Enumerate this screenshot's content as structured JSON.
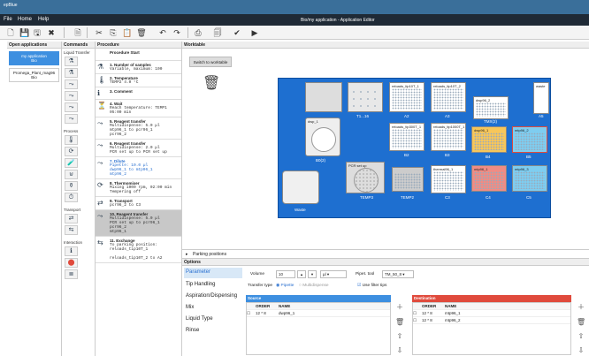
{
  "window": {
    "app": "epBlue",
    "title": "Bio/my application - Application Editor"
  },
  "menu": [
    "File",
    "Home",
    "Help"
  ],
  "panels": {
    "open": "Open applications",
    "commands": "Commands",
    "procedure": "Procedure",
    "worktable": "Worktable",
    "options": "Options"
  },
  "apps": [
    {
      "name": "my application",
      "sub": "Bio"
    },
    {
      "name": "Promega_Plant_mag96",
      "sub": "Bio"
    }
  ],
  "cmdgroups": [
    "Liquid Transfer",
    "Process",
    "Transport",
    "Interaction"
  ],
  "steps": [
    {
      "t": "Procedure Start",
      "d": ""
    },
    {
      "t": "1. Number of samples",
      "d": "Variable, maximum: 100"
    },
    {
      "t": "2. Temperature",
      "d": "TEMP2 4.0 °C"
    },
    {
      "t": "3. Comment",
      "d": ""
    },
    {
      "t": "4. Wait",
      "d": "Reach temperature: TEMP1\n05:00 min"
    },
    {
      "t": "5. Reagent transfer",
      "d": "Multidispense: 5.0 µl\nmtp96_1 to pcr96_1\npcr96_2"
    },
    {
      "t": "6. Reagent transfer",
      "d": "Multidispense: 2.0 µl\nPCR set up to PCR set up"
    },
    {
      "t": "7. Dilute",
      "d": "Pipette: 10.0 µl\ndwp96_1 to mtp96_1\nmtp96_2"
    },
    {
      "t": "8. Thermomixer",
      "d": "Mixing 1000 rpm, 02:00 min\nTempering off"
    },
    {
      "t": "9. Transport",
      "d": "pcr96_2 to C3"
    },
    {
      "t": "10. Reagent transfer",
      "d": "Multidispense: 5.0 µl\nPCR set up to pcr96_1\npcr96_2\nmtp96_1"
    },
    {
      "t": "11. Exchange",
      "d": "To parking position:\nreloads_tip10T_1\n\nreloads_tip10T_2 to A2"
    }
  ],
  "worktable": {
    "switch": "Switch to worktable",
    "parking": "Parking positions"
  },
  "labware": {
    "a1": "T1...16",
    "a2": "reloads_tip10T_1",
    "a2p": "A2",
    "a3": "reloads_tip10T_2",
    "a3p": "A3",
    "a4": "dwp96_2",
    "a4p": "TMX(2)",
    "a5": "waste",
    "a5p": "A5",
    "b0": "dwp_1",
    "b0p": "B0(2)",
    "b2": "reloads_tip300T_1",
    "b2p": "B2",
    "b3": "reloads_tip1000T_1",
    "b3p": "B3",
    "b4": "dwp96_1",
    "b4p": "B4",
    "b5": "mtp96_2",
    "b5p": "B5",
    "pcr": "PCR set up",
    "temp3": "TEMP3",
    "temp2": "TEMP2",
    "c2": "thermal96_1",
    "c3p": "C3",
    "c4": "mtp96_1",
    "c4p": "C4",
    "c5": "mtp96_3",
    "c5p": "C5",
    "waste": "Waste"
  },
  "options": {
    "tabs": [
      "Parameter",
      "Tip Handling",
      "Aspiration/Dispensing",
      "Mix",
      "Liquid Type",
      "Rinse"
    ],
    "volume_label": "Volume",
    "volume": "10",
    "unit": "µl",
    "tool_label": "Pipet. tool",
    "tool": "TM_50_8",
    "transfer_label": "Transfer type",
    "pipette": "Pipette",
    "multi": "Multidispense",
    "filter": "Use filter tips",
    "source": "Source",
    "destination": "Destination",
    "order": "ORDER",
    "name": "NAME",
    "src_rows": [
      {
        "o": "12 * 8",
        "n": "dwp96_1"
      }
    ],
    "dst_rows": [
      {
        "o": "12 * 8",
        "n": "mtp96_1"
      },
      {
        "o": "12 * 8",
        "n": "mtp96_2"
      }
    ]
  },
  "colors": {
    "accent": "#3d8fe0",
    "deck": "#1e6fd0",
    "source": "#3d8fe0",
    "dest": "#e04a3c"
  }
}
